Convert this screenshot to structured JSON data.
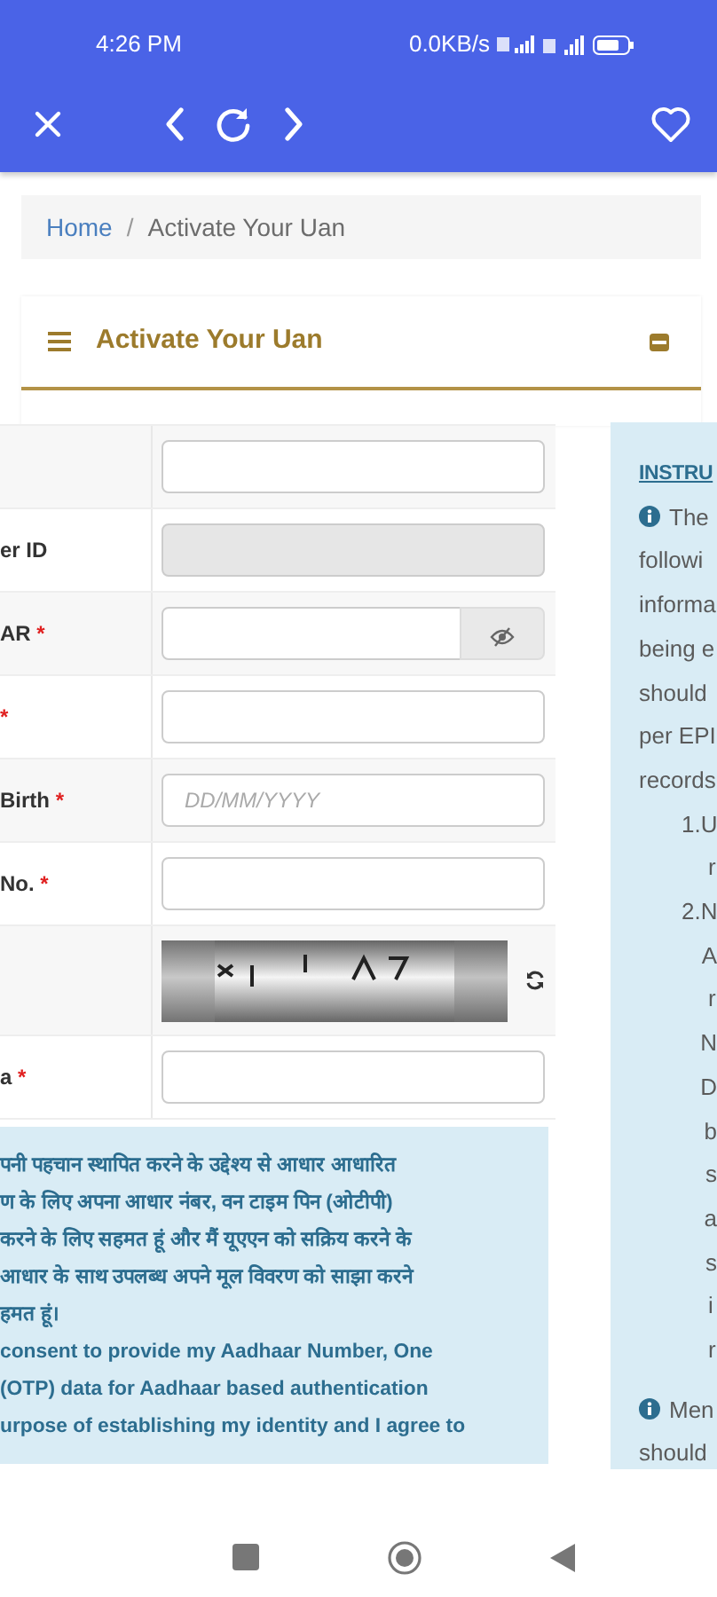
{
  "status_bar": {
    "time": "4:26 PM",
    "network_speed": "0.0KB/s"
  },
  "breadcrumb_separator": "/",
  "required_mark": "*",
  "breadcrumb": [
    {
      "label": "Home",
      "active": false
    },
    {
      "label": "Activate Your Uan",
      "active": true
    }
  ],
  "card": {
    "title": "Activate Your Uan"
  },
  "form_rows": [
    {
      "kind": "text",
      "required": false,
      "disabled": false
    },
    {
      "kind": "text",
      "label": "er ID",
      "required": false,
      "disabled": true
    },
    {
      "kind": "password",
      "label": "AR",
      "required": true,
      "disabled": false
    },
    {
      "kind": "text",
      "required": true,
      "disabled": false
    },
    {
      "kind": "text",
      "label": "Birth",
      "required": true,
      "disabled": false,
      "placeholder": "DD/MM/YYYY"
    },
    {
      "kind": "text",
      "label": "No.",
      "required": true,
      "disabled": false
    },
    {
      "kind": "captcha",
      "required": false
    },
    {
      "kind": "text",
      "label": "a",
      "required": true,
      "disabled": false
    }
  ],
  "consent_lines": [
    "पनी पहचान स्थापित करने के उद्देश्य से आधार आधारित",
    "ण के लिए अपना आधार नंबर, वन टाइम पिन (ओटीपी)",
    "करने के लिए सहमत हूं और मैं यूएएन को सक्रिय करने के",
    "आधार के साथ उपलब्ध अपने मूल विवरण को साझा करने",
    "हमत हूं।",
    "consent to provide my Aadhaar Number, One",
    "(OTP) data for Aadhaar based authentication",
    "urpose of establishing my identity and I agree to"
  ],
  "instructions": {
    "heading": "INSTRU",
    "blocks": [
      {
        "kind": "info",
        "lines": [
          "The",
          "followi",
          "informa",
          "being e",
          "should",
          "per EPI",
          "records"
        ]
      },
      {
        "kind": "item",
        "number": "1.",
        "lines": [
          "U",
          "r"
        ]
      },
      {
        "kind": "item",
        "number": "2.",
        "lines": [
          "N",
          "A",
          "r",
          "N",
          "D",
          "b",
          "s",
          "a",
          "s",
          "i",
          "r"
        ]
      },
      {
        "kind": "info",
        "lines": [
          "Men",
          "should"
        ]
      }
    ]
  }
}
